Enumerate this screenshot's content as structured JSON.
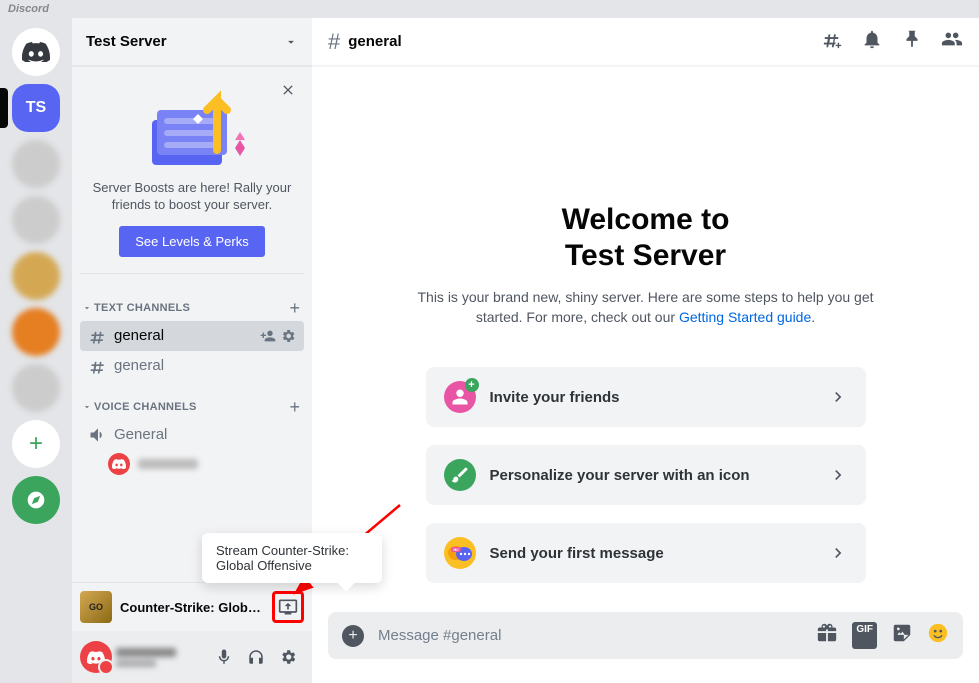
{
  "app_title": "Discord",
  "server": {
    "name": "Test Server"
  },
  "boost": {
    "text": "Server Boosts are here! Rally your friends to boost your server.",
    "button": "See Levels & Perks"
  },
  "categories": {
    "text": {
      "label": "TEXT CHANNELS"
    },
    "voice": {
      "label": "VOICE CHANNELS"
    }
  },
  "channels": {
    "general1": "general",
    "general2": "general",
    "voice_general": "General"
  },
  "activity": {
    "name": "Counter-Strike: Global ...",
    "tooltip": "Stream Counter-Strike: Global Offensive",
    "icon_text": "GO"
  },
  "chat": {
    "channel": "general",
    "welcome_title_1": "Welcome to",
    "welcome_title_2": "Test Server",
    "welcome_text_1": "This is your brand new, shiny server. Here are some steps to help you get started. For more, check out our ",
    "welcome_link": "Getting Started guide",
    "welcome_text_2": "."
  },
  "actions": {
    "invite": "Invite your friends",
    "personalize": "Personalize your server with an icon",
    "message": "Send your first message"
  },
  "composer": {
    "placeholder": "Message #general"
  },
  "guild_selected": "TS"
}
